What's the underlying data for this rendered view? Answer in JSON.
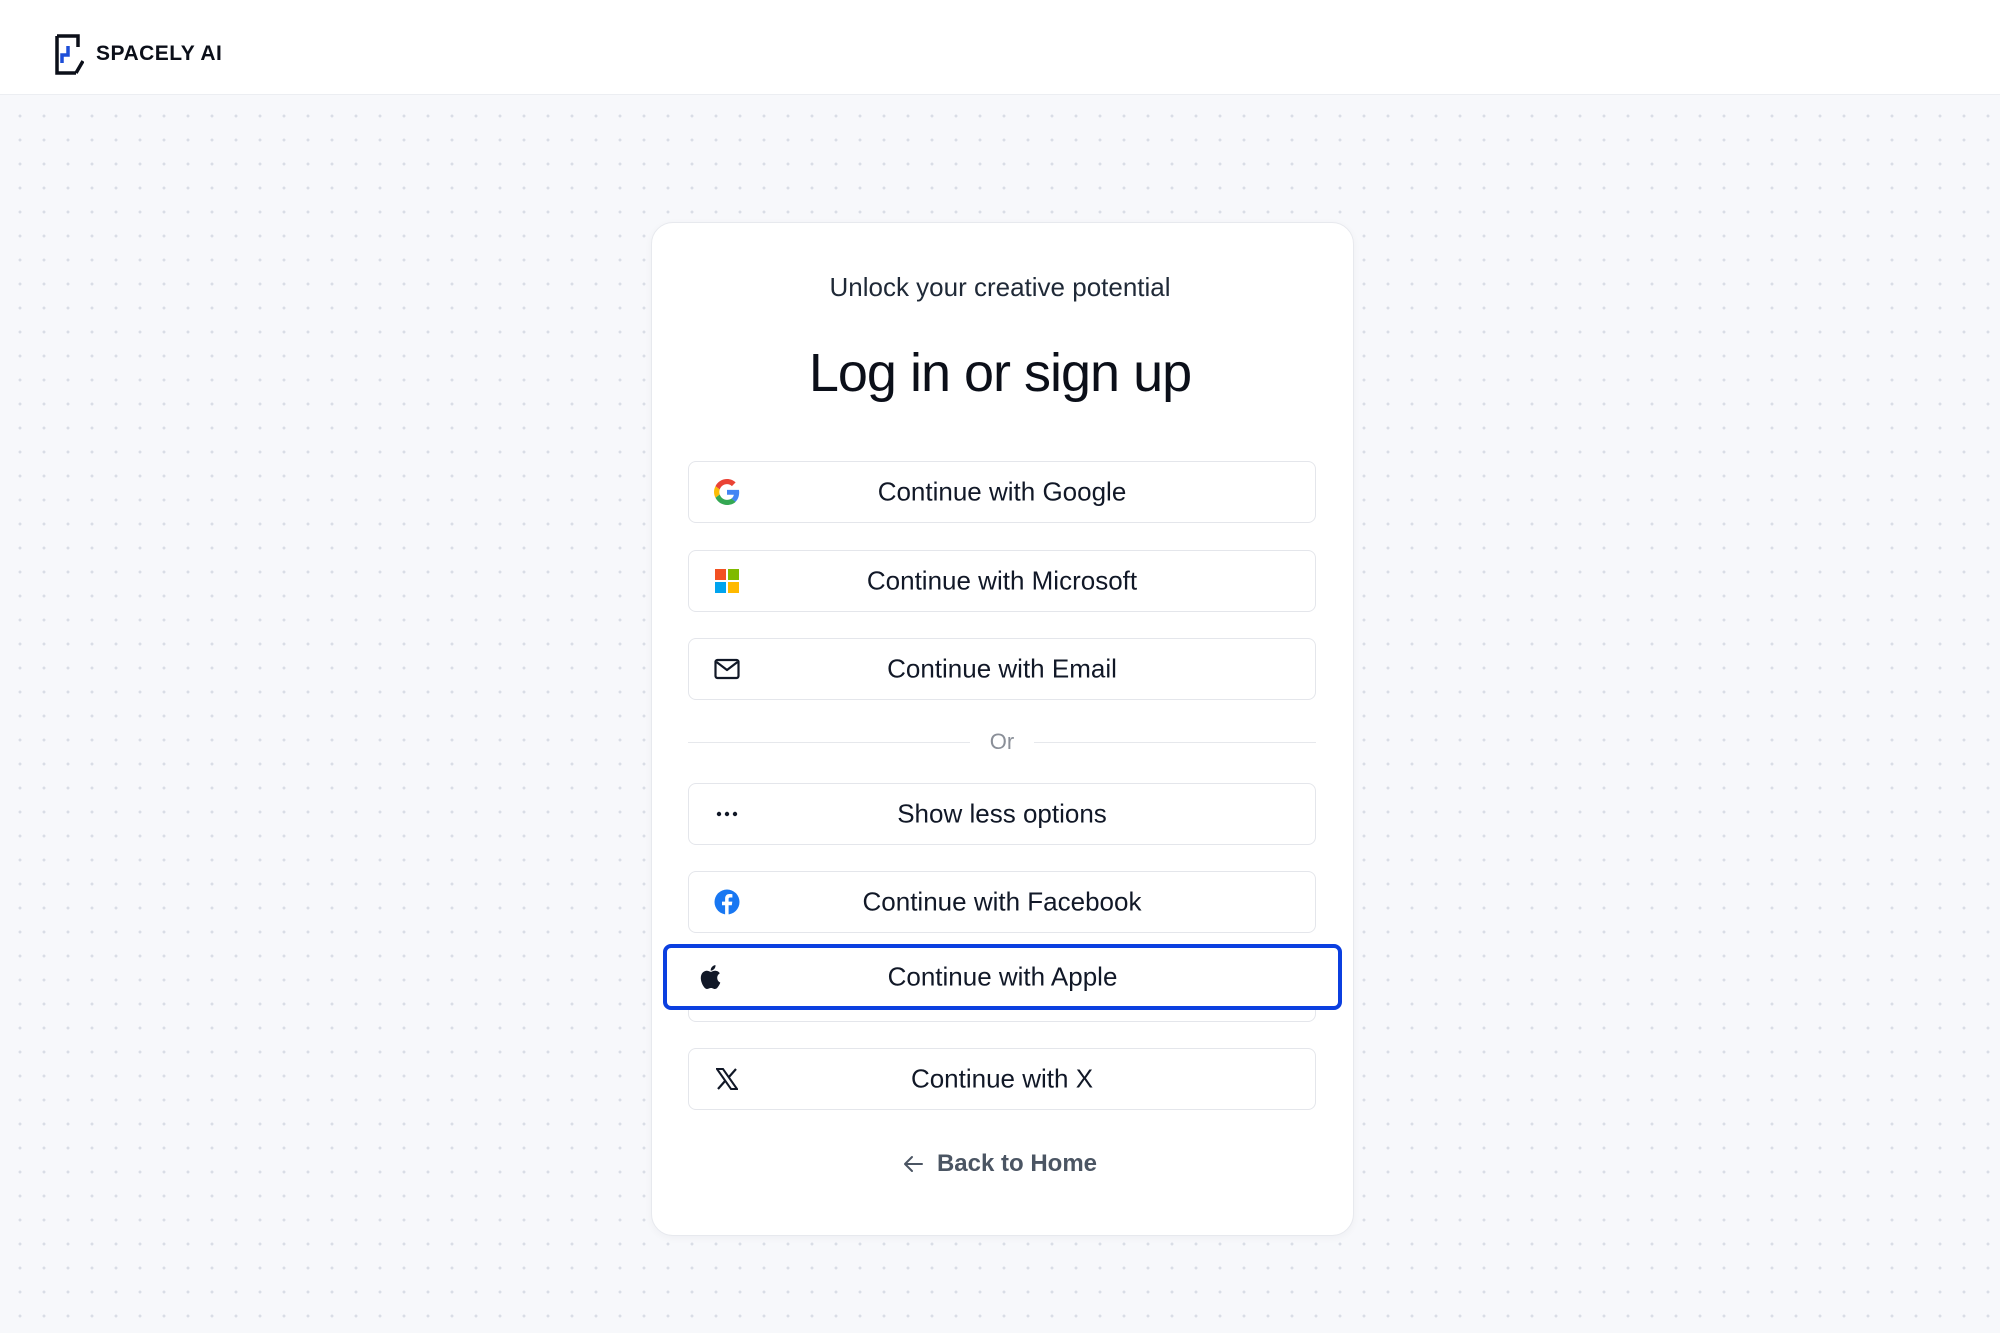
{
  "brand": {
    "name": "SPACELY AI"
  },
  "card": {
    "subtitle": "Unlock your creative potential",
    "title": "Log in or sign up"
  },
  "buttons": {
    "google": {
      "label": "Continue with Google",
      "icon": "google-icon"
    },
    "microsoft": {
      "label": "Continue with Microsoft",
      "icon": "microsoft-icon"
    },
    "email": {
      "label": "Continue with Email",
      "icon": "mail-icon"
    },
    "show_less": {
      "label": "Show less options",
      "icon": "ellipsis-icon"
    },
    "facebook": {
      "label": "Continue with Facebook",
      "icon": "facebook-icon"
    },
    "apple": {
      "label": "Continue with Apple",
      "icon": "apple-icon",
      "focused": true
    },
    "x": {
      "label": "Continue with X",
      "icon": "x-icon"
    }
  },
  "divider": {
    "label": "Or"
  },
  "back": {
    "label": "Back to Home",
    "icon": "arrow-left-icon"
  },
  "colors": {
    "focus_ring": "#0b3fe0",
    "brand_blue": "#1d4ed8",
    "facebook_blue": "#1877f2",
    "background": "#f7f8fb"
  }
}
